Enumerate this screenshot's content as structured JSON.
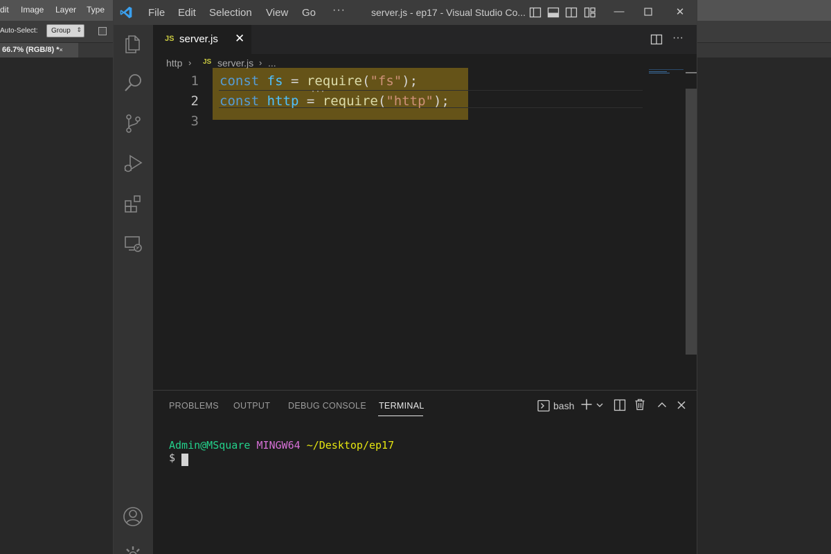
{
  "photoshop": {
    "menu": [
      "dit",
      "Image",
      "Layer",
      "Type"
    ],
    "auto_select_label": "Auto-Select:",
    "group_select": "Group",
    "doc_tab": "66.7% (RGB/8) *",
    "doc_tab_close": "×"
  },
  "vscode": {
    "menu": [
      "File",
      "Edit",
      "Selection",
      "View",
      "Go"
    ],
    "menu_more": "···",
    "window_title": "server.js - ep17 - Visual Studio Co...",
    "tab": {
      "icon_label": "JS",
      "label": "server.js",
      "close": "✕"
    },
    "breadcrumb": {
      "folder": "http",
      "icon_label": "JS",
      "file": "server.js",
      "ellipsis": "..."
    },
    "editor": {
      "line_numbers": [
        "1",
        "2",
        "3"
      ],
      "lines": [
        {
          "keyword": "const",
          "name": "fs",
          "op": "=",
          "fn": "require",
          "open": "(",
          "str": "\"fs\"",
          "close": ");"
        },
        {
          "keyword": "const",
          "name": "http",
          "op": "=",
          "fn": "require",
          "open": "(",
          "str": "\"http\"",
          "close": ");"
        }
      ],
      "active_line": 2
    },
    "panel": {
      "tabs": [
        "PROBLEMS",
        "OUTPUT",
        "DEBUG CONSOLE",
        "TERMINAL"
      ],
      "active_tab": "TERMINAL",
      "shell": "bash"
    },
    "terminal": {
      "user": "Admin@MSquare",
      "host": "MINGW64",
      "path": "~/Desktop/ep17",
      "prompt": "$"
    },
    "colors": {
      "highlight": "#a18014",
      "accent": "#007acc",
      "js_icon": "#cbcb41"
    }
  }
}
